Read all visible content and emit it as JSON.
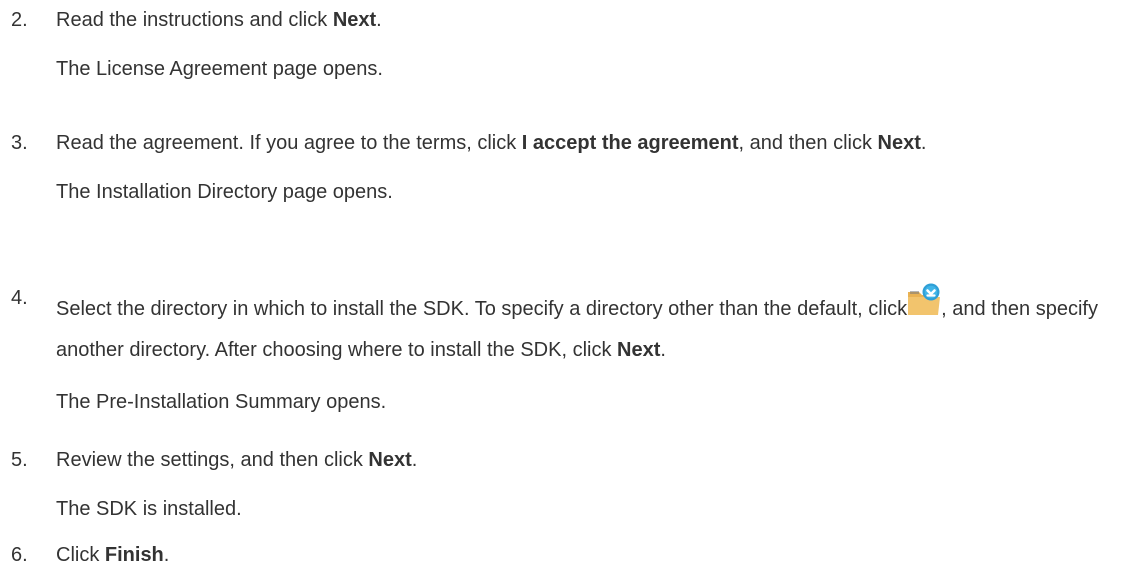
{
  "steps": [
    {
      "number": "2.",
      "instruction": {
        "pre": "Read the instructions and click ",
        "action": "Next",
        "post": "."
      },
      "result": "The License Agreement page opens."
    },
    {
      "number": "3.",
      "instruction": {
        "pre": "Read the agreement. If you agree to the terms, click ",
        "action1": "I accept the agreement",
        "mid": ", and then click ",
        "action2": "Next",
        "post": "."
      },
      "result": "The Installation Directory page opens."
    },
    {
      "number": "4.",
      "instruction": {
        "pre": "Select the directory in which to install the SDK. To specify a directory other than the default, click",
        "icon": "folder-browse-icon",
        "mid": ", and then specify another directory. After choosing where to install the SDK, click ",
        "action": "Next",
        "post": "."
      },
      "result": "The Pre-Installation Summary opens."
    },
    {
      "number": "5.",
      "instruction": {
        "pre": "Review the settings, and then click ",
        "action": "Next",
        "post": "."
      },
      "result": "The SDK is installed."
    },
    {
      "number": "6.",
      "instruction": {
        "pre": "Click ",
        "action": "Finish",
        "post": "."
      }
    }
  ],
  "colors": {
    "text": "#333333",
    "folder": "#f2c46d",
    "badge": "#2f9fd6"
  }
}
